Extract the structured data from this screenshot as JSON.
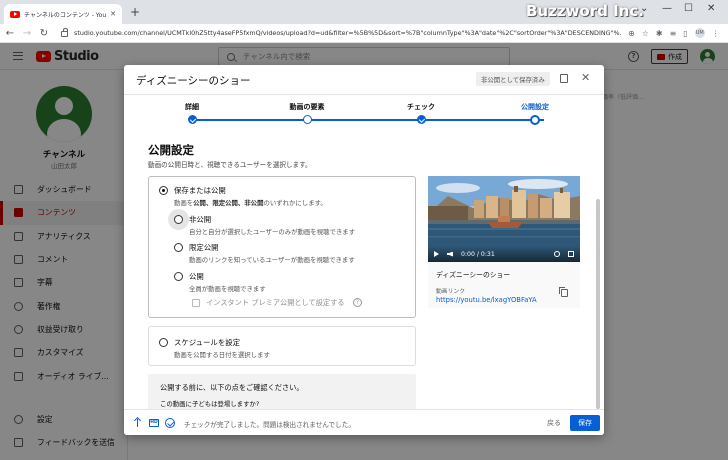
{
  "browser": {
    "tab_title": "チャンネルのコンテンツ - YouTube Studio",
    "tab_close": "✕",
    "new_tab": "+",
    "url": "studio.youtube.com/channel/UCMTkl0hZ5tty4aseFP5fxmQ/videos/upload?d=ud&filter=%5B%5D&sort=%7B\"columnType\"%3A\"date\"%2C\"sortOrder\"%3A\"DESCENDING\"%...",
    "watermark": "Buzzword Inc.",
    "profile_initials": "UM",
    "window_controls": [
      "⌄",
      "—",
      "☐",
      "✕"
    ]
  },
  "studio": {
    "logo_text": "Studio",
    "search_placeholder": "チャンネル内で検索",
    "help": "?",
    "create_label": "作成"
  },
  "sidebar": {
    "channel_name": "チャンネル",
    "channel_owner": "山田太郎",
    "items": [
      {
        "label": "ダッシュボード",
        "icon": "dashboard-icon"
      },
      {
        "label": "コンテンツ",
        "icon": "content-icon",
        "active": true
      },
      {
        "label": "アナリティクス",
        "icon": "analytics-icon"
      },
      {
        "label": "コメント",
        "icon": "comments-icon"
      },
      {
        "label": "字幕",
        "icon": "subtitles-icon"
      },
      {
        "label": "著作権",
        "icon": "copyright-icon"
      },
      {
        "label": "収益受け取り",
        "icon": "monetization-icon"
      },
      {
        "label": "カスタマイズ",
        "icon": "customize-icon"
      },
      {
        "label": "オーディオ ライブ...",
        "icon": "audio-library-icon"
      }
    ],
    "bottom_items": [
      {
        "label": "設定",
        "icon": "settings-icon"
      },
      {
        "label": "フィードバックを送信",
        "icon": "feedback-icon"
      }
    ]
  },
  "page_behind": {
    "columns_hint": "コメント　高評価率（低評価..."
  },
  "dialog": {
    "title": "ディズニーシーのショー",
    "saved_badge": "非公開として保存済み",
    "close": "✕",
    "steps": [
      {
        "label": "詳細",
        "state": "done"
      },
      {
        "label": "動画の要素",
        "state": "visited"
      },
      {
        "label": "チェック",
        "state": "done"
      },
      {
        "label": "公開設定",
        "state": "current"
      }
    ],
    "section_title": "公開設定",
    "section_desc": "動画の公開日時と、視聴できるユーザーを選択します。",
    "save_or_publish": {
      "label": "保存または公開",
      "desc_prefix": "動画を",
      "desc_bold": "公開、限定公開、非公開",
      "desc_suffix": "のいずれかにします。",
      "selected": true
    },
    "visibility_options": [
      {
        "label": "非公開",
        "desc": "自分と自分が選択したユーザーのみが動画を視聴できます",
        "selected": false,
        "hover": true
      },
      {
        "label": "限定公開",
        "desc": "動画のリンクを知っているユーザーが動画を視聴できます",
        "selected": false
      },
      {
        "label": "公開",
        "desc": "全員が動画を視聴できます",
        "selected": false
      }
    ],
    "premiere_label": "インスタント プレミア公開として設定する",
    "premiere_help": "?",
    "schedule": {
      "label": "スケジュールを設定",
      "desc": "動画を公開する日付を選択します"
    },
    "precheck": {
      "title": "公開する前に、以下の点をご確認ください。",
      "question": "この動画に子どもは登場しますか?"
    },
    "video": {
      "time": "0:00 / 0:31",
      "title": "ディズニーシーのショー",
      "link_label": "動画リンク",
      "link": "https://youtu.be/lxagYOBFaYA"
    },
    "footer": {
      "hd_text": "HD",
      "status": "チェックが完了しました。問題は検出されませんでした。",
      "back_label": "戻る",
      "save_label": "保存"
    }
  },
  "colors": {
    "accent_blue": "#065fd4",
    "active_red": "#cc0000",
    "overlay": "rgba(0,0,0,0.47)"
  }
}
